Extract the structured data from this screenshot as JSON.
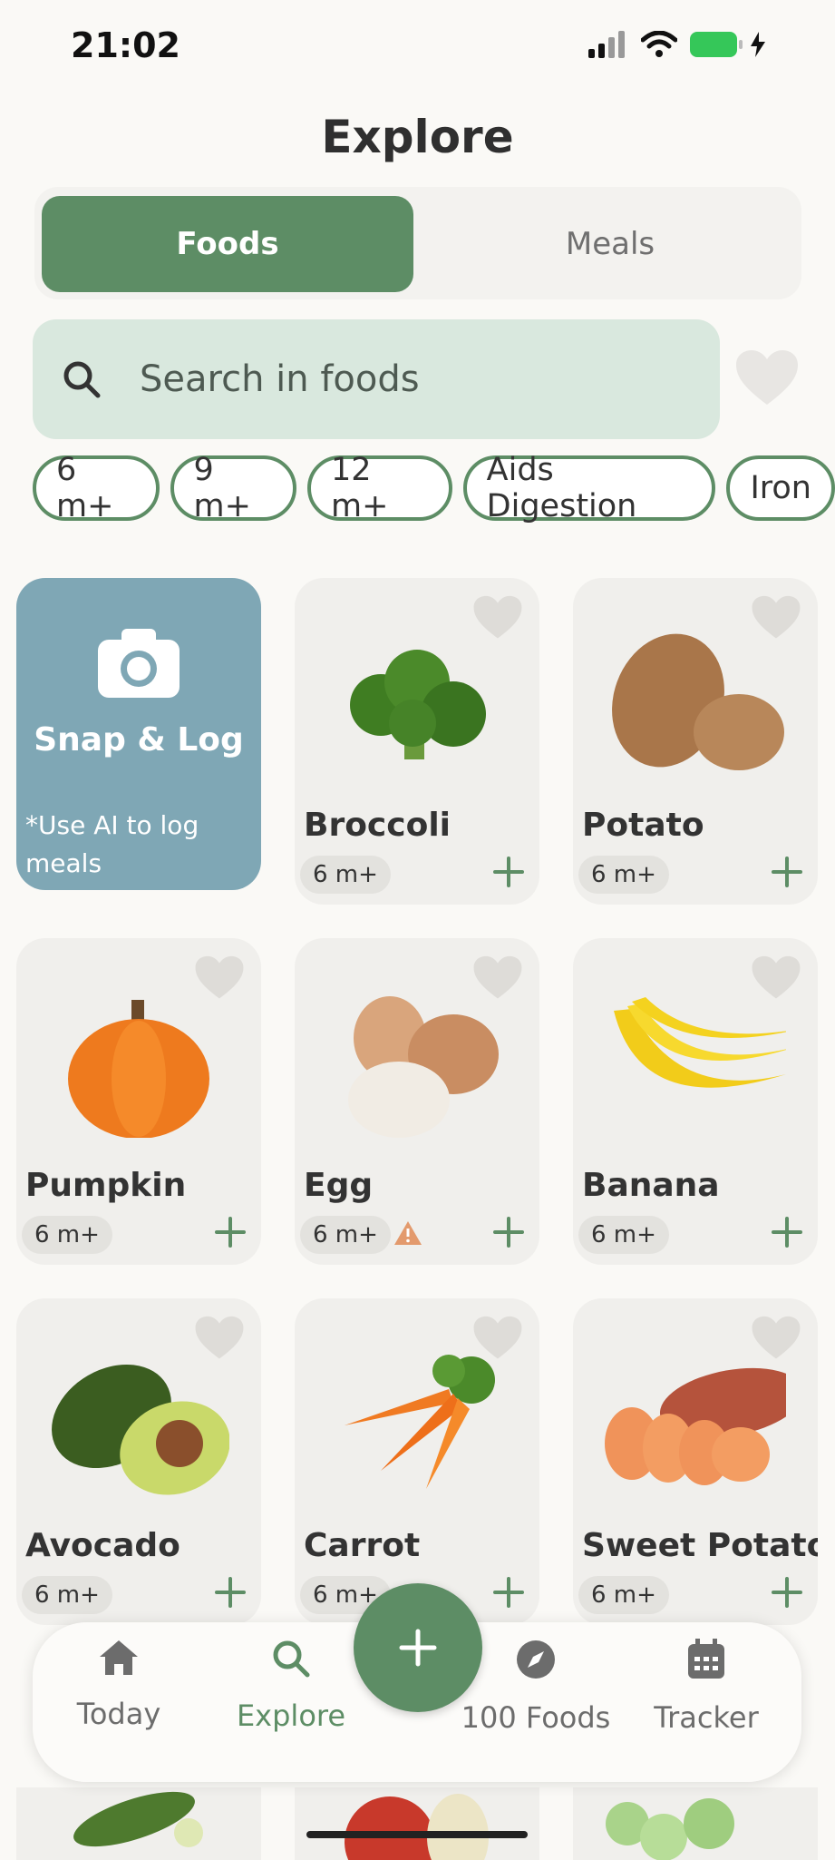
{
  "status_bar": {
    "time": "21:02"
  },
  "page": {
    "title": "Explore"
  },
  "tabs": [
    {
      "label": "Foods",
      "active": true
    },
    {
      "label": "Meals",
      "active": false
    }
  ],
  "search": {
    "placeholder": "Search in foods"
  },
  "filters": [
    "6 m+",
    "9 m+",
    "12 m+",
    "Aids Digestion",
    "Iron"
  ],
  "snap": {
    "title": "Snap & Log",
    "note": "*Use AI to log meals"
  },
  "foods": [
    {
      "name": "Broccoli",
      "age": "6 m+",
      "icon": "broccoli"
    },
    {
      "name": "Potato",
      "age": "6 m+",
      "icon": "potato"
    },
    {
      "name": "Pumpkin",
      "age": "6 m+",
      "icon": "pumpkin"
    },
    {
      "name": "Egg",
      "age": "6 m+",
      "icon": "egg",
      "warning": true
    },
    {
      "name": "Banana",
      "age": "6 m+",
      "icon": "banana"
    },
    {
      "name": "Avocado",
      "age": "6 m+",
      "icon": "avocado"
    },
    {
      "name": "Carrot",
      "age": "6 m+",
      "icon": "carrot"
    },
    {
      "name": "Sweet Potato",
      "age": "6 m+",
      "icon": "sweet-potato"
    }
  ],
  "nav": [
    {
      "label": "Today",
      "icon": "home-icon"
    },
    {
      "label": "Explore",
      "icon": "search-icon",
      "active": true
    },
    {
      "label": "100 Foods",
      "icon": "compass-icon"
    },
    {
      "label": "Tracker",
      "icon": "calendar-icon"
    }
  ],
  "colors": {
    "accent": "#5d8d65",
    "snap_card": "#7fa7b5",
    "search_bg": "#d9e8de"
  }
}
